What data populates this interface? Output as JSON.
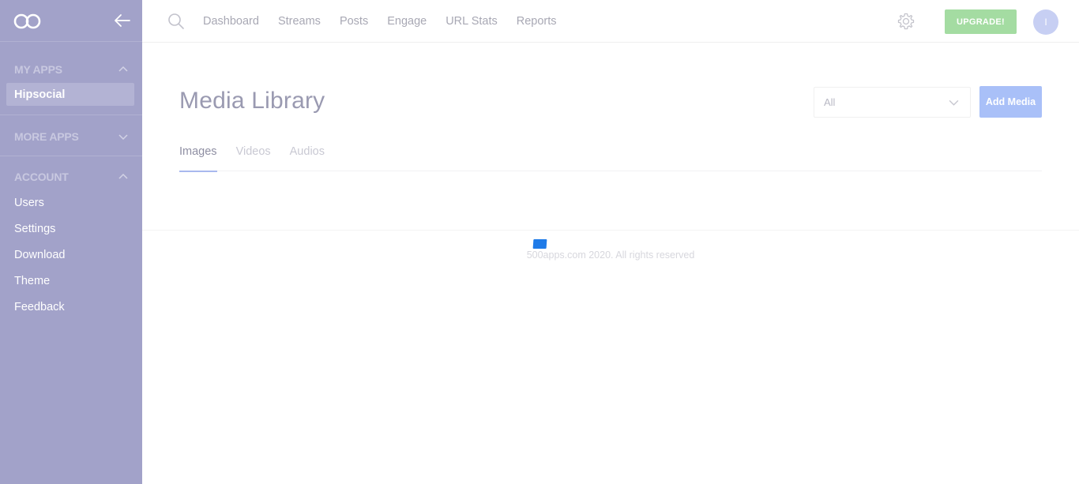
{
  "sidebar": {
    "sections": {
      "my_apps": {
        "title": "MY APPS",
        "items": [
          "Hipsocial"
        ]
      },
      "more_apps": {
        "title": "MORE APPS"
      },
      "account": {
        "title": "ACCOUNT",
        "items": [
          "Users",
          "Settings",
          "Download",
          "Theme",
          "Feedback"
        ]
      }
    }
  },
  "topnav": {
    "links": [
      "Dashboard",
      "Streams",
      "Posts",
      "Engage",
      "URL Stats",
      "Reports"
    ],
    "upgrade_label": "UPGRADE!",
    "avatar_initial": "I"
  },
  "main": {
    "title": "Media Library",
    "filter_value": "All",
    "add_media_label": "Add Media",
    "tabs": [
      "Images",
      "Videos",
      "Audios"
    ],
    "active_tab": "Images"
  },
  "footer": {
    "text": "500apps.com 2020. All rights reserved"
  },
  "colors": {
    "sidebar_bg": "#a2a2c9",
    "upgrade_bg": "#a4dca2",
    "add_media_bg": "#a9c0f8",
    "loader": "#1f7be8"
  }
}
